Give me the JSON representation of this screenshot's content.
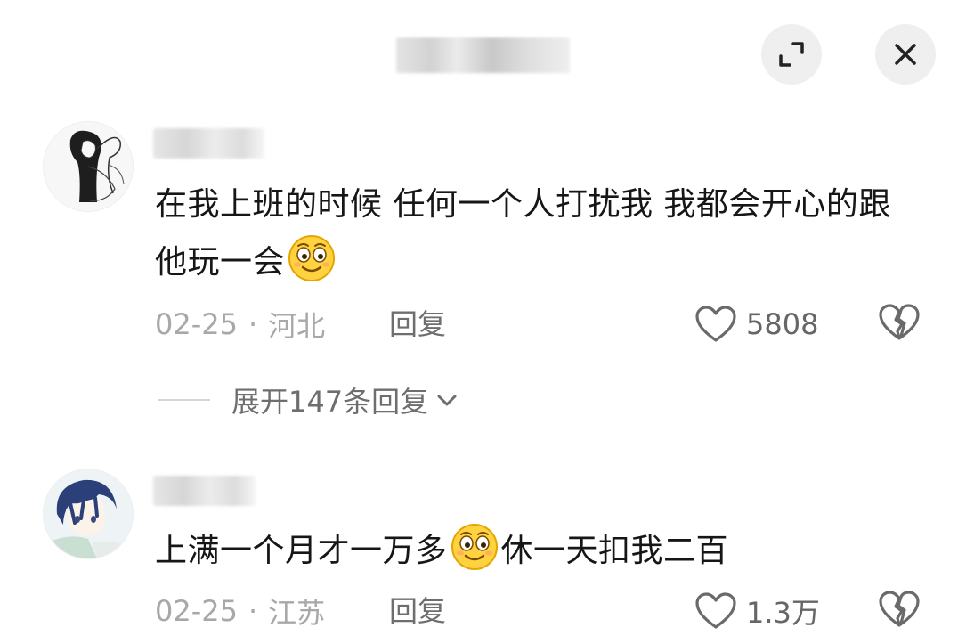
{
  "header": {
    "title_blurred": true,
    "expand_icon": "expand-icon",
    "close_icon": "close-icon"
  },
  "comments": [
    {
      "avatar": "avatar-illustration-girl",
      "username_blurred": true,
      "text_part1": "在我上班的时候 任何一个人打扰我 我都会开心的跟他玩一会",
      "emoji": "smirk-face-emoji",
      "date": "02-25",
      "separator": "·",
      "location": "河北",
      "reply_label": "回复",
      "like_count": "5808",
      "expand_replies_label": "展开147条回复"
    },
    {
      "avatar": "avatar-illustration-boy",
      "username_blurred": true,
      "text_part1": "上满一个月才一万多",
      "emoji": "smirk-face-emoji",
      "text_part2": "休一天扣我二百",
      "date": "02-25",
      "separator": "·",
      "location": "江苏",
      "reply_label": "回复",
      "like_count": "1.3万"
    }
  ],
  "colors": {
    "text": "#161616",
    "meta": "#a8a8a8",
    "secondary": "#6e6e6e",
    "button_bg": "#efefef"
  }
}
